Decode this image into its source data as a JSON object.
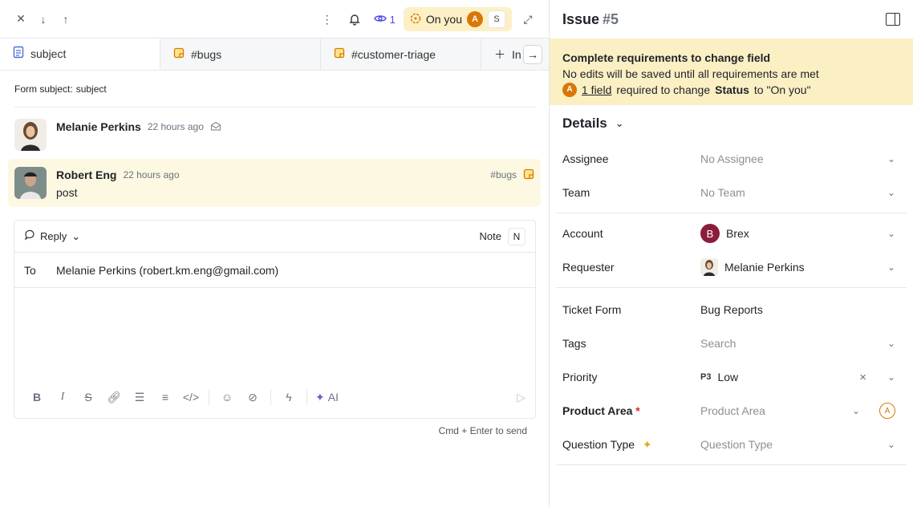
{
  "topbar": {
    "watchers": "1",
    "status_label": "On you",
    "assignee_initial": "A",
    "secondary_initial": "S"
  },
  "tabs": [
    {
      "label": "subject",
      "icon": "document-icon"
    },
    {
      "label": "#bugs",
      "icon": "note-icon"
    },
    {
      "label": "#customer-triage",
      "icon": "note-icon"
    },
    {
      "label": "In",
      "icon": "plus-icon"
    }
  ],
  "form_subject": {
    "label": "Form subject:",
    "value": "subject"
  },
  "messages": [
    {
      "author": "Melanie Perkins",
      "time": "22 hours ago",
      "icon": "email-icon"
    },
    {
      "author": "Robert Eng",
      "time": "22 hours ago",
      "tag": "#bugs",
      "text": "post"
    }
  ],
  "composer": {
    "mode": "Reply",
    "note_label": "Note",
    "note_key": "N",
    "to_label": "To",
    "to_value": "Melanie Perkins (robert.km.eng@gmail.com)",
    "ai_label": "AI",
    "hint": "Cmd + Enter to send"
  },
  "issue": {
    "title": "Issue",
    "number": "#5"
  },
  "banner": {
    "title": "Complete requirements to change field",
    "line2": "No edits will be saved until all requirements are met",
    "avatar": "A",
    "link": "1 field",
    "text_a": "required to change",
    "field": "Status",
    "text_b": "to \"On you\""
  },
  "details": {
    "title": "Details",
    "assignee": {
      "label": "Assignee",
      "value": "No Assignee"
    },
    "team": {
      "label": "Team",
      "value": "No Team"
    },
    "account": {
      "label": "Account",
      "value": "Brex",
      "initial": "B"
    },
    "requester": {
      "label": "Requester",
      "value": "Melanie Perkins"
    },
    "ticket_form": {
      "label": "Ticket Form",
      "value": "Bug Reports"
    },
    "tags": {
      "label": "Tags",
      "value": "Search"
    },
    "priority": {
      "label": "Priority",
      "code": "P3",
      "value": "Low"
    },
    "product_area": {
      "label": "Product Area",
      "required_mark": "*",
      "value": "Product Area",
      "avatar": "A"
    },
    "question_type": {
      "label": "Question Type",
      "value": "Question Type"
    }
  },
  "colors": {
    "status_bg": "#fdf0c6",
    "banner_bg": "#fbefc4",
    "highlight_bg": "#fdf8e1",
    "accent_orange": "#d97706",
    "watch_blue": "#4f46e5",
    "brex": "#8c1d3a"
  }
}
